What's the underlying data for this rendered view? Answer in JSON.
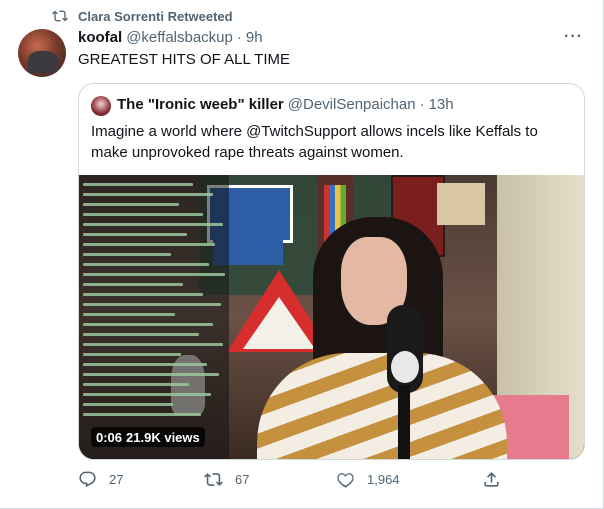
{
  "retweet_banner": {
    "icon": "retweet-icon",
    "text": "Clara Sorrenti Retweeted"
  },
  "tweet": {
    "author_name": "koofal",
    "author_handle": "@keffalsbackup",
    "separator": "·",
    "time": "9h",
    "more": "···",
    "text": "GREATEST HITS OF ALL TIME"
  },
  "quote": {
    "author_name": "The \"Ironic weeb\" killer",
    "author_handle": "@DevilSenpaichan",
    "separator": "·",
    "time": "13h",
    "text": "Imagine a world where @TwitchSupport allows incels like Keffals to make unprovoked rape threats against women.",
    "media": {
      "duration": "0:06",
      "views": "21.9K views"
    }
  },
  "actions": {
    "reply": {
      "icon": "reply-icon",
      "count": "27"
    },
    "retweet": {
      "icon": "retweet-icon",
      "count": "67"
    },
    "like": {
      "icon": "heart-icon",
      "count": "1,964"
    },
    "share": {
      "icon": "share-icon"
    }
  },
  "colors": {
    "text": "#0f1419",
    "secondary": "#536471",
    "border": "#cfd9de"
  }
}
